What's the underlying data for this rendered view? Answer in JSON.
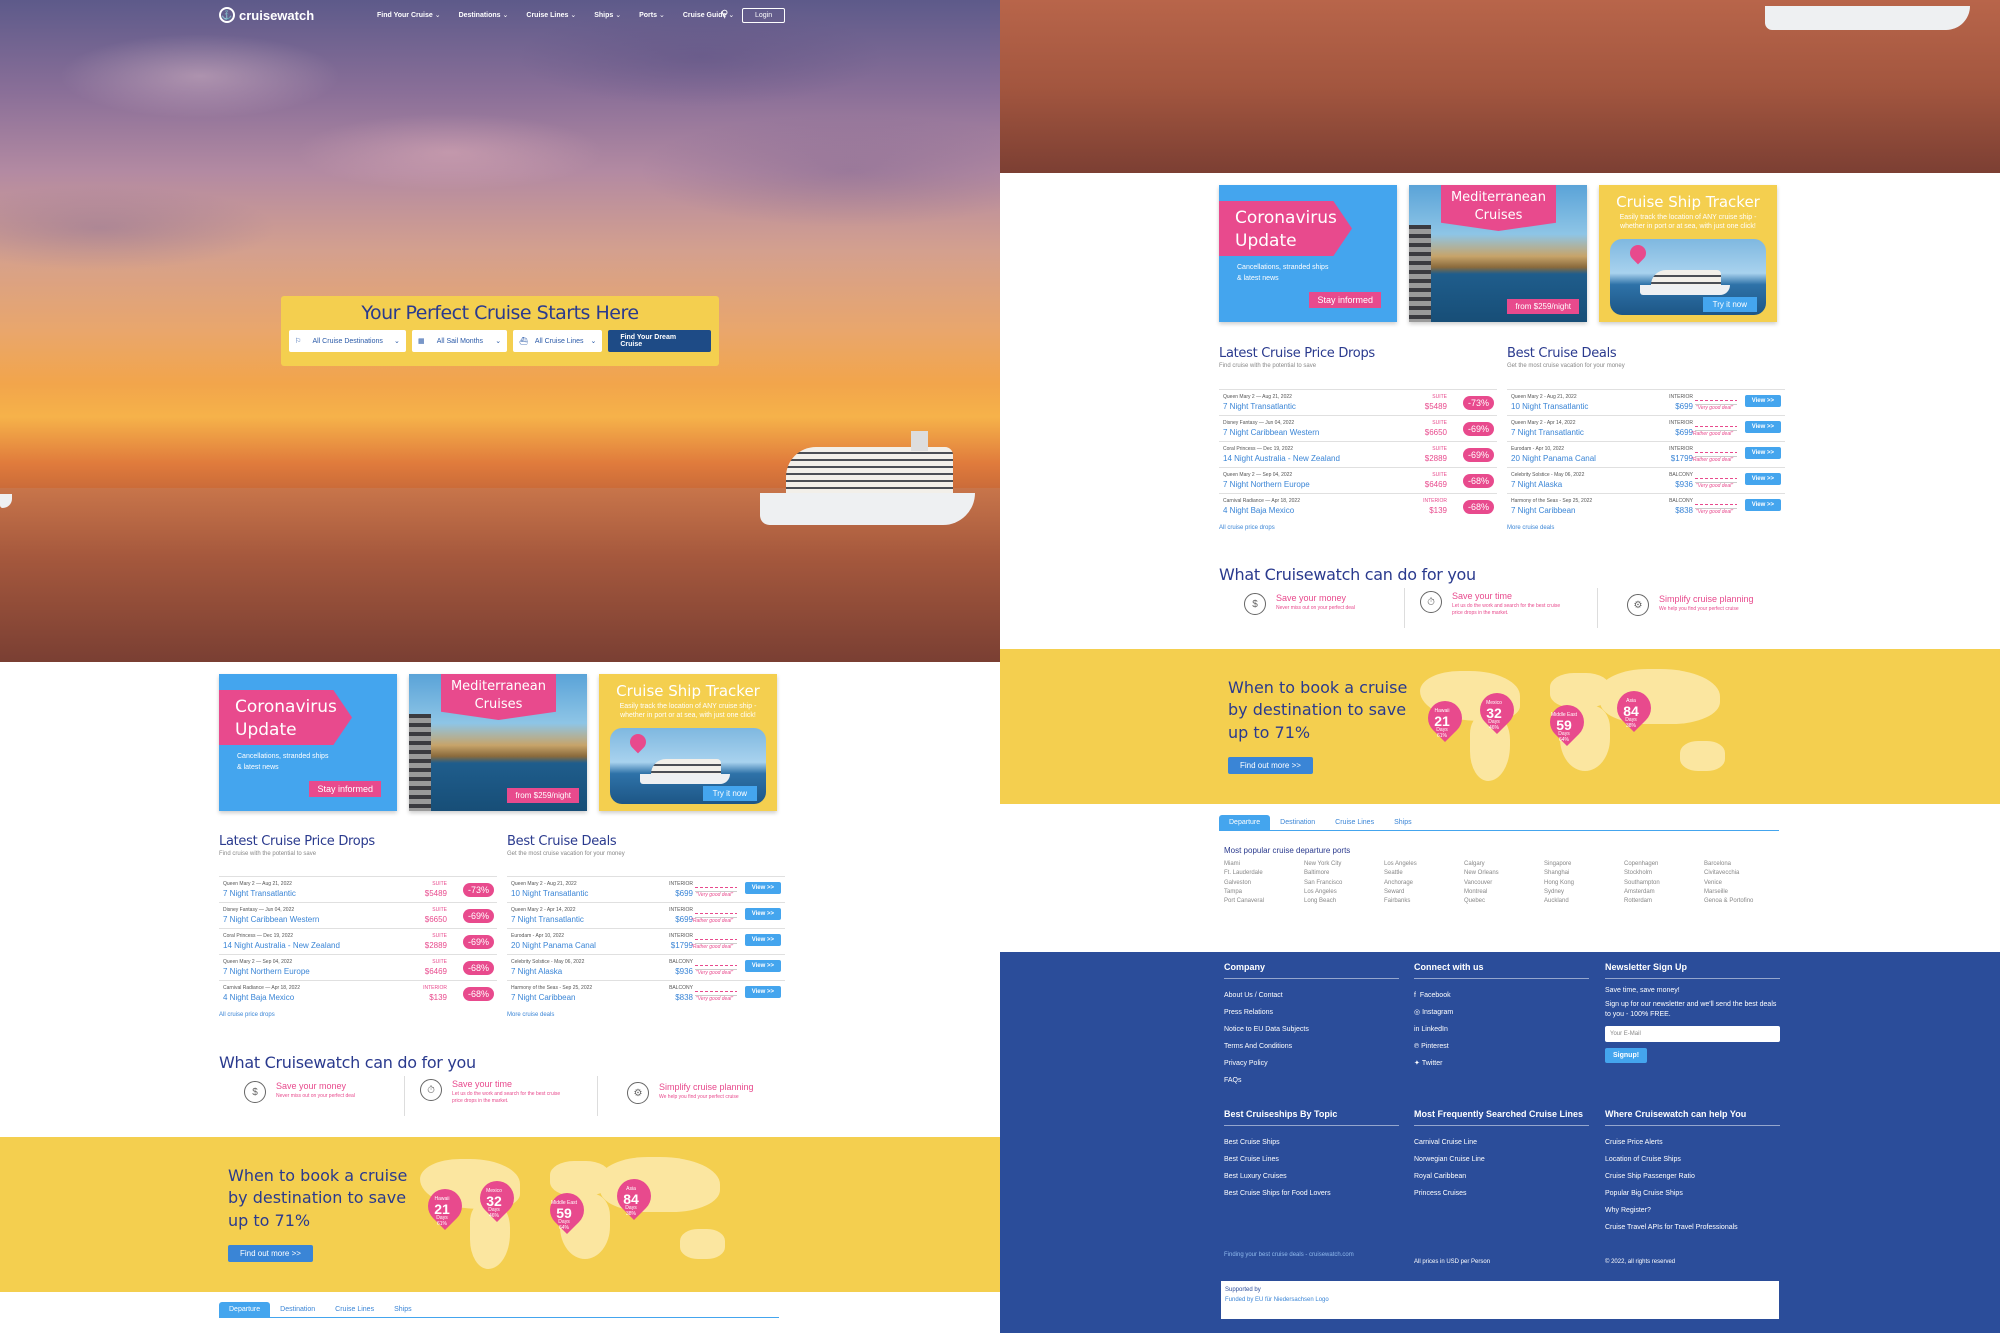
{
  "nav": {
    "logo": "cruisewatch",
    "items": [
      "Find Your Cruise",
      "Destinations",
      "Cruise Lines",
      "Ships",
      "Ports",
      "Cruise Guide"
    ],
    "login": "Login"
  },
  "hero": {
    "title": "Your Perfect Cruise Starts Here",
    "destinations": "All Cruise Destinations",
    "months": "All Sail Months",
    "lines": "All Cruise Lines",
    "button": "Find Your Dream Cruise"
  },
  "cards": {
    "corona": {
      "title1": "Coronavirus",
      "title2": "Update",
      "sub1": "Cancellations, stranded ships",
      "sub2": "& latest news",
      "button": "Stay informed"
    },
    "med": {
      "title1": "Mediterranean",
      "title2": "Cruises",
      "price": "from $259/night"
    },
    "tracker": {
      "title": "Cruise Ship Tracker",
      "desc": "Easily track the location of ANY cruise ship - whether in port or at sea, with just one click!",
      "button": "Try it now"
    }
  },
  "drops": {
    "title": "Latest Cruise Price Drops",
    "subtitle": "Find cruise with the potential to save",
    "more": "All cruise price drops",
    "rows": [
      {
        "ship": "Queen Mary 2 — Aug 21, 2022",
        "name": "7 Night Transatlantic",
        "cabin": "SUITE",
        "price": "$5489",
        "pct": "-73%"
      },
      {
        "ship": "Disney Fantasy — Jun 04, 2022",
        "name": "7 Night Caribbean Western",
        "cabin": "SUITE",
        "price": "$6650",
        "pct": "-69%"
      },
      {
        "ship": "Coral Princess — Dec 19, 2022",
        "name": "14 Night Australia - New Zealand",
        "cabin": "SUITE",
        "price": "$2889",
        "pct": "-69%"
      },
      {
        "ship": "Queen Mary 2 — Sep 04, 2022",
        "name": "7 Night Northern Europe",
        "cabin": "SUITE",
        "price": "$6469",
        "pct": "-68%"
      },
      {
        "ship": "Carnival Radiance — Apr 18, 2022",
        "name": "4 Night Baja Mexico",
        "cabin": "INTERIOR",
        "price": "$139",
        "pct": "-68%"
      }
    ]
  },
  "deals": {
    "title": "Best Cruise Deals",
    "subtitle": "Get the most cruise vacation for your money",
    "more": "More cruise deals",
    "view": "View >>",
    "rows": [
      {
        "ship": "Queen Mary 2 - Aug 21, 2022",
        "name": "10 Night Transatlantic",
        "cabin": "INTERIOR",
        "price": "$699",
        "note": "\"Very good deal\""
      },
      {
        "ship": "Queen Mary 2 - Apr 14, 2022",
        "name": "7 Night Transatlantic",
        "cabin": "INTERIOR",
        "price": "$699",
        "note": "\"Rather good deal\""
      },
      {
        "ship": "Eurodam - Apr 10, 2022",
        "name": "20 Night Panama Canal",
        "cabin": "INTERIOR",
        "price": "$1799",
        "note": "\"Rather good deal\""
      },
      {
        "ship": "Celebrity Solstice - May 06, 2022",
        "name": "7 Night Alaska",
        "cabin": "BALCONY",
        "price": "$936",
        "note": "\"Very good deal\""
      },
      {
        "ship": "Harmony of the Seas - Sep 25, 2022",
        "name": "7 Night Caribbean",
        "cabin": "BALCONY",
        "price": "$838",
        "note": "\"Very good deal\""
      }
    ]
  },
  "what": {
    "title": "What Cruisewatch can do for you",
    "items": [
      {
        "title": "Save your money",
        "desc": "Never miss out on your perfect deal"
      },
      {
        "title": "Save your time",
        "desc": "Let us do the work and search for the best cruise price drops in the market."
      },
      {
        "title": "Simplify cruise planning",
        "desc": "We help you find your perfect cruise"
      }
    ]
  },
  "book": {
    "line1": "When to book a cruise",
    "line2": "by destination to save",
    "line3": "up to 71%",
    "button": "Find out more >>",
    "pins": [
      {
        "label": "Hawaii",
        "days": "21",
        "unit": "Days",
        "pct": "61%"
      },
      {
        "label": "Mexico",
        "days": "32",
        "unit": "Days",
        "pct": "46%"
      },
      {
        "label": "Middle East",
        "days": "59",
        "unit": "Days",
        "pct": "64%"
      },
      {
        "label": "Asia",
        "days": "84",
        "unit": "Days",
        "pct": "38%"
      }
    ]
  },
  "tabs": [
    "Departure",
    "Destination",
    "Cruise Lines",
    "Ships"
  ],
  "ports": {
    "title": "Most popular cruise departure ports",
    "cols": [
      [
        "Miami",
        "Ft. Lauderdale",
        "Galveston",
        "Tampa",
        "Port Canaveral"
      ],
      [
        "New York City",
        "Baltimore",
        "San Francisco",
        "Los Angeles",
        "Long Beach"
      ],
      [
        "Los Angeles",
        "Seattle",
        "Anchorage",
        "Seward",
        "Fairbanks"
      ],
      [
        "Calgary",
        "New Orleans",
        "Vancouver",
        "Montreal",
        "Quebec"
      ],
      [
        "Singapore",
        "Shanghai",
        "Hong Kong",
        "Sydney",
        "Auckland"
      ],
      [
        "Copenhagen",
        "Stockholm",
        "Southampton",
        "Amsterdam",
        "Rotterdam"
      ],
      [
        "Barcelona",
        "Civitavecchia",
        "Venice",
        "Marseille",
        "Genoa & Portofino"
      ]
    ]
  },
  "footer": {
    "company": {
      "title": "Company",
      "items": [
        "About Us / Contact",
        "Press Relations",
        "Notice to EU Data Subjects",
        "Terms And Conditions",
        "Privacy Policy",
        "FAQs"
      ]
    },
    "connect": {
      "title": "Connect with us",
      "items": [
        "Facebook",
        "Instagram",
        "LinkedIn",
        "Pinterest",
        "Twitter"
      ]
    },
    "newsletter": {
      "title": "Newsletter Sign Up",
      "tag": "Save time, save money!",
      "desc": "Sign up for our newsletter and we'll send the best deals to you - 100% FREE.",
      "placeholder": "Your E-Mail",
      "button": "Signup!"
    },
    "topic": {
      "title": "Best Cruiseships By Topic",
      "items": [
        "Best Cruise Ships",
        "Best Cruise Lines",
        "Best Luxury Cruises",
        "Best Cruise Ships for Food Lovers"
      ]
    },
    "searched": {
      "title": "Most Frequently Searched Cruise Lines",
      "items": [
        "Carnival Cruise Line",
        "Norwegian Cruise Line",
        "Royal Caribbean",
        "Princess Cruises"
      ]
    },
    "help": {
      "title": "Where Cruisewatch can help You",
      "items": [
        "Cruise Price Alerts",
        "Location of Cruise Ships",
        "Cruise Ship Passenger Ratio",
        "Popular Big Cruise Ships",
        "Why Register?",
        "Cruise Travel APIs for Travel Professionals"
      ]
    },
    "logoalt": "Finding your best cruise deals - cruisewatch.com",
    "prices": "All prices in USD per Person",
    "copyright": "© 2022, all rights reserved",
    "supported": "Supported by",
    "funded": "Funded by EU für Niedersachsen Logo"
  }
}
